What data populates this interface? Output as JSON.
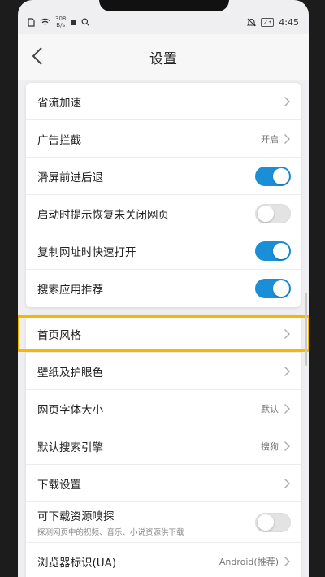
{
  "status_bar": {
    "speed_value": "308",
    "speed_unit": "B/s",
    "battery": "23",
    "time": "4:45"
  },
  "header": {
    "title": "设置"
  },
  "group1": [
    {
      "label": "省流加速",
      "type": "chevron"
    },
    {
      "label": "广告拦截",
      "type": "value",
      "value": "开启"
    },
    {
      "label": "滑屏前进后退",
      "type": "toggle",
      "on": true
    },
    {
      "label": "启动时提示恢复未关闭网页",
      "type": "toggle",
      "on": false
    },
    {
      "label": "复制网址时快速打开",
      "type": "toggle",
      "on": true
    },
    {
      "label": "搜索应用推荐",
      "type": "toggle",
      "on": true
    }
  ],
  "group2": [
    {
      "label": "首页风格",
      "type": "chevron",
      "highlighted": true
    },
    {
      "label": "壁纸及护眼色",
      "type": "chevron"
    },
    {
      "label": "网页字体大小",
      "type": "value",
      "value": "默认"
    },
    {
      "label": "默认搜索引擎",
      "type": "value",
      "value": "搜狗"
    },
    {
      "label": "下载设置",
      "type": "chevron"
    },
    {
      "label": "可下载资源嗅探",
      "type": "toggle",
      "on": false,
      "sub": "探测网页中的视频、音乐、小说资源供下载"
    },
    {
      "label": "浏览器标识(UA)",
      "type": "value",
      "value": "Android(推荐)"
    }
  ],
  "colors": {
    "accent": "#1a8fd8",
    "highlight": "#f5b800"
  }
}
